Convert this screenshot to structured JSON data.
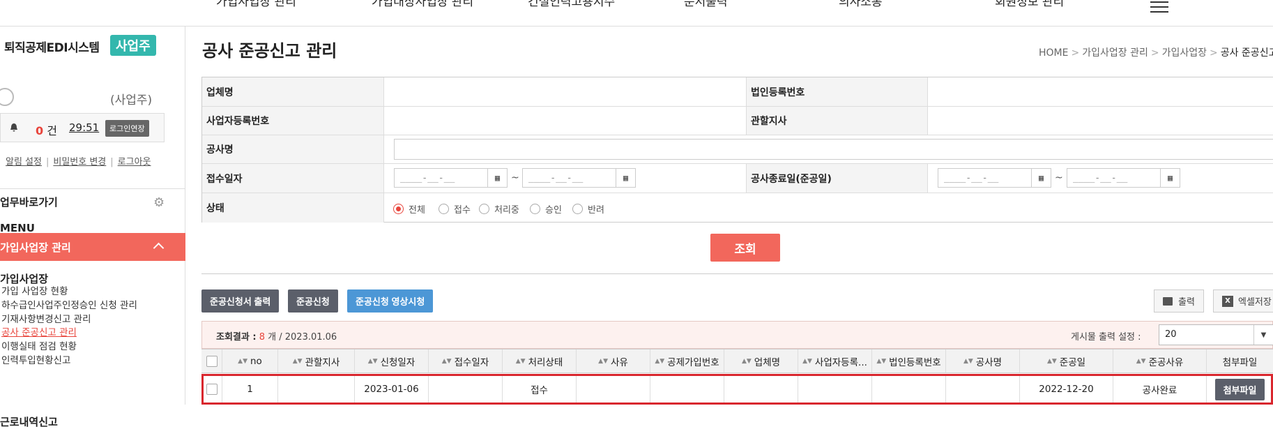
{
  "top_nav": {
    "items": [
      "가입사업장 관리",
      "가입대상사업장 관리",
      "건설인력고용지수",
      "문서출력",
      "의사소통",
      "회원정보 관리"
    ]
  },
  "sidebar": {
    "brand": "퇴직공제EDI시스템",
    "brand_badge": "사업주",
    "user_role": "(사업주)",
    "notice_count": "0",
    "notice_unit": "건",
    "timer": "29:51",
    "extend_label": "로그인연장",
    "links": [
      "알림 설정",
      "비밀번호 변경",
      "로그아웃"
    ],
    "quick_label": "업무바로가기",
    "menu_label": "MENU",
    "active_menu": "가입사업장 관리",
    "submenu_title": "가입사업장",
    "submenu_items": [
      "가입 사업장 현황",
      "하수급인사업주인정승인 신청 관리",
      "기재사항변경신고 관리",
      "공사 준공신고 관리",
      "이행실태 점검 현황",
      "인력투입현황신고"
    ],
    "active_submenu_index": 3,
    "next_section": "근로내역신고"
  },
  "page": {
    "title": "공사 준공신고 관리",
    "breadcrumb": [
      "HOME",
      "가입사업장 관리",
      "가입사업장",
      "공사 준공신고 관리"
    ]
  },
  "search_form": {
    "company_label": "업체명",
    "corp_reg_label": "법인등록번호",
    "biz_reg_label": "사업자등록번호",
    "branch_label": "관할지사",
    "project_label": "공사명",
    "received_label": "접수일자",
    "completion_label": "공사종료일(준공일)",
    "status_label": "상태",
    "date_placeholder": "____-__-__",
    "tilde": "~",
    "status_options": [
      "전체",
      "접수",
      "처리중",
      "승인",
      "반려"
    ],
    "status_selected": "전체",
    "search_button": "조회"
  },
  "actions": {
    "print_form": "준공신청서 출력",
    "apply": "준공신청",
    "video": "준공신청 영상시청",
    "print": "출력",
    "excel": "엑셀저장"
  },
  "result": {
    "label": "조회결과 :",
    "count": "8",
    "unit": "개",
    "date": "/ 2023.01.06",
    "page_size_label": "게시물 출력 설정 :",
    "page_size": "20"
  },
  "table": {
    "columns": [
      "no",
      "관할지사",
      "신청일자",
      "접수일자",
      "처리상태",
      "사유",
      "공제가입번호",
      "업체명",
      "사업자등록...",
      "법인등록번호",
      "공사명",
      "준공일",
      "준공사유",
      "첨부파일"
    ],
    "rows": [
      {
        "no": "1",
        "branch": "",
        "applied": "2023-01-06",
        "received": "",
        "status": "접수",
        "reason": "",
        "member_no": "",
        "company": "",
        "biz_no": "",
        "corp_no": "",
        "project": "",
        "completion": "2022-12-20",
        "completion_reason": "공사완료",
        "attach": "첨부파일"
      }
    ]
  }
}
